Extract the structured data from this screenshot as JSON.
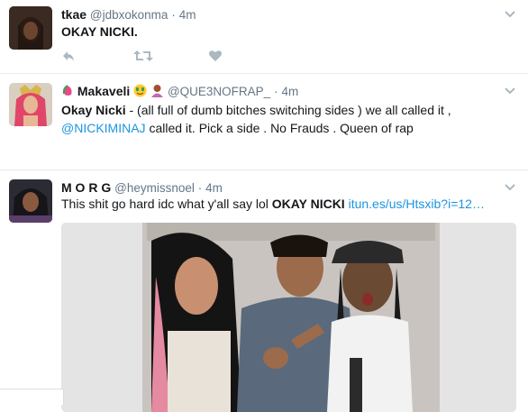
{
  "tweets": [
    {
      "name": "tkae",
      "handle": "@jdbxokonma",
      "sep": "·",
      "time": "4m",
      "body": "OKAY NICKI."
    },
    {
      "name": "Makaveli",
      "handle": "@QUE3NOFRAP_",
      "sep": "·",
      "time": "4m",
      "body_bold": "Okay Nicki",
      "body_text": " - (all full of dumb bitches switching sides ) we all called it ,",
      "mention": "@NICKIMINAJ",
      "body_text2": " called it. Pick a side . No Frauds . Queen of rap"
    },
    {
      "name": "M O R G",
      "handle": "@heymissnoel",
      "sep": "·",
      "time": "4m",
      "body_text": "This shit go hard idc what y'all say lol ",
      "body_bold": "OKAY NICKI",
      "link": "itun.es/us/Htsxib?i=12…"
    }
  ],
  "colors": {
    "text": "#14171a",
    "meta": "#657786",
    "link": "#1b95e0",
    "icon": "#aab8c2",
    "divider": "#e6ecf0"
  },
  "icons": {
    "reply": "reply-icon",
    "retweet": "retweet-icon",
    "like": "heart-icon",
    "menu": "chevron-down-icon"
  }
}
